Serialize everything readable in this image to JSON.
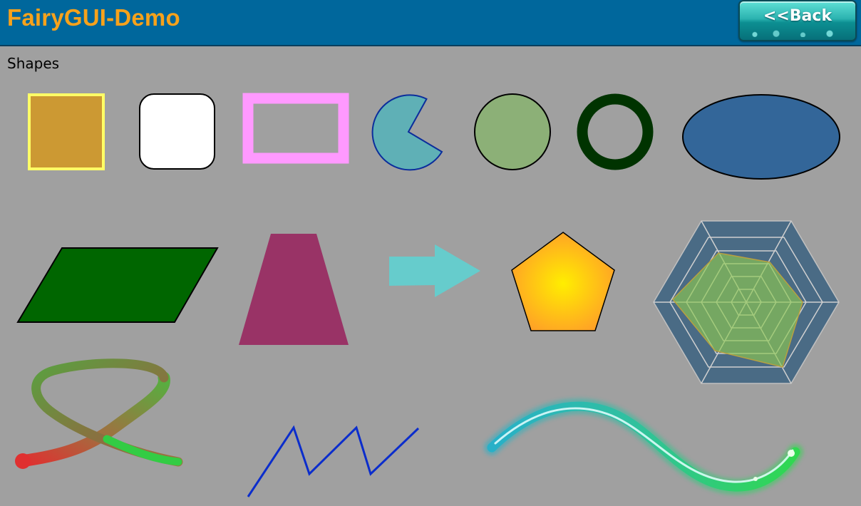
{
  "header": {
    "title": "FairyGUI-Demo",
    "back_label": "<<Back",
    "background": "#00679c",
    "title_color": "#f7a21b"
  },
  "main": {
    "section_title": "Shapes"
  },
  "shapes": [
    {
      "name": "filled-square",
      "fill": "#cc9933",
      "stroke": "#ffff66"
    },
    {
      "name": "rounded-rectangle",
      "fill": "#ffffff",
      "stroke": "#000000"
    },
    {
      "name": "hollow-rectangle",
      "stroke": "#ff99ff"
    },
    {
      "name": "pie-sector",
      "fill": "#5fb0b6",
      "stroke": "#0b2d9c"
    },
    {
      "name": "circle",
      "fill": "#8cb077",
      "stroke": "#000000"
    },
    {
      "name": "ring",
      "stroke": "#003300"
    },
    {
      "name": "ellipse",
      "fill": "#336699",
      "stroke": "#000000"
    },
    {
      "name": "parallelogram",
      "fill": "#006600",
      "stroke": "#000000"
    },
    {
      "name": "trapezoid",
      "fill": "#993366"
    },
    {
      "name": "arrow",
      "fill": "#66cccc"
    },
    {
      "name": "pentagon",
      "fill": "#ffa020",
      "stroke": "#000000"
    },
    {
      "name": "radar-chart",
      "fill": "#4a6b85",
      "grid": "#c8c8c8",
      "data_fill": "#8cc850"
    },
    {
      "name": "gradient-stroke-line",
      "colors": [
        "#e03030",
        "#33cc44"
      ]
    },
    {
      "name": "zigzag-line",
      "stroke": "#0b2dcc"
    },
    {
      "name": "glow-curve",
      "colors": [
        "#30b8d0",
        "#33dd55"
      ]
    }
  ]
}
